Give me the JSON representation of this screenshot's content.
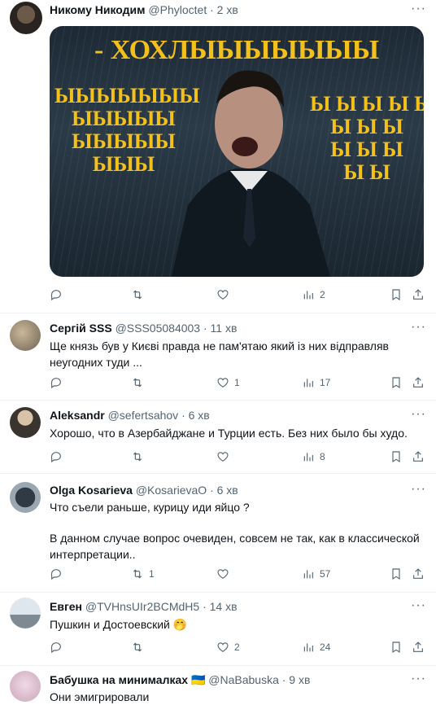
{
  "tweets": [
    {
      "name": "Никому Никодим",
      "handle": "@Phyloctet",
      "time": "· 2 хв",
      "meme": {
        "title": "- ХОХЛЫЫЫЫЫЫЫ",
        "left_text": "ЫЫЫЫЫЫЫ\nЫЫЫЫЫ\nЫЫЫЫЫ\nЫЫЫ",
        "right_text": "Ы Ы Ы Ы Ы\nЫ Ы Ы\nЫ Ы Ы\nЫ Ы"
      },
      "stats": {
        "replies": "",
        "retweets": "",
        "likes": "",
        "views": "2"
      }
    },
    {
      "name": "Сергій SSS",
      "handle": "@SSS05084003",
      "time": "· 11 хв",
      "text": "Ще князь був у Києві правда не пам'ятаю який із них відправляв неугодних туди ...",
      "stats": {
        "replies": "",
        "retweets": "",
        "likes": "1",
        "views": "17"
      }
    },
    {
      "name": "Aleksandr",
      "handle": "@sefertsahov",
      "time": "· 6 хв",
      "text": "Хорошо, что в Азербайджане и Турции есть. Без них было бы худо.",
      "stats": {
        "replies": "",
        "retweets": "",
        "likes": "",
        "views": "8"
      }
    },
    {
      "name": "Olga Kosarieva",
      "handle": "@KosarievaO",
      "time": "· 6 хв",
      "text1": "Что съели раньше, курицу иди яйцо ?",
      "text2": "В данном случае вопрос очевиден, совсем не так, как в классической интерпретации..",
      "stats": {
        "replies": "",
        "retweets": "1",
        "likes": "",
        "views": "57"
      }
    },
    {
      "name": "Евген",
      "handle": "@TVHnsUIr2BCMdH5",
      "time": "· 14 хв",
      "text": "Пушкин и Достоевский 🤭",
      "stats": {
        "replies": "",
        "retweets": "",
        "likes": "2",
        "views": "24"
      }
    },
    {
      "name": "Бабушка на минималках",
      "flag": "🇺🇦",
      "handle": "@NaBabuska",
      "time": "· 9 хв",
      "text": "Они эмигрировали"
    }
  ],
  "icons": {
    "more": "more-icon",
    "reply": "reply-icon",
    "retweet": "retweet-icon",
    "like": "like-icon",
    "views": "views-icon",
    "bookmark": "bookmark-icon",
    "share": "share-icon"
  }
}
